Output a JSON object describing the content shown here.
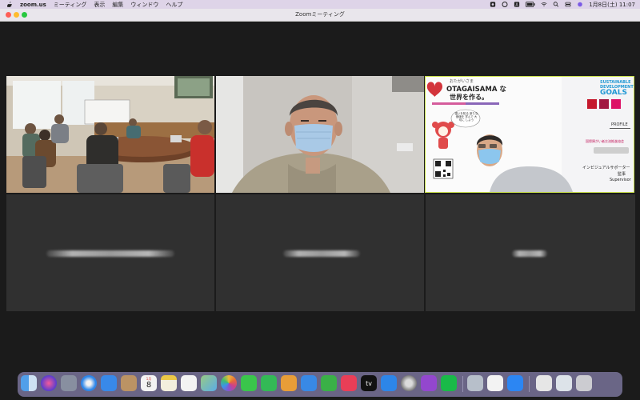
{
  "menubar": {
    "apple_icon": "apple-icon",
    "app_name": "zoom.us",
    "menus": [
      "ミーティング",
      "表示",
      "編集",
      "ウィンドウ",
      "ヘルプ"
    ],
    "datetime": "1月8日(土) 11:07"
  },
  "window": {
    "title": "Zoomミーティング"
  },
  "video_tiles": [
    {
      "type": "conference-room"
    },
    {
      "type": "participant-masked"
    },
    {
      "type": "presentation-slide"
    },
    {
      "type": "video-off"
    },
    {
      "type": "video-off"
    },
    {
      "type": "video-off"
    }
  ],
  "slide": {
    "logo_top": "おたがいさま",
    "headline_1": "OTAGAISAMA な",
    "headline_2": "世界を作る。",
    "sdg_title_1": "SUSTAINABLE",
    "sdg_title_2": "DEVELOPMENT",
    "sdg_title_3": "GOALS",
    "profile": "PROFILE",
    "org": "国際障がい者交流推進協会",
    "role_1": "インビジュアルサポーター",
    "role_2": "監事",
    "role_3": "Supervisor",
    "speech": "違いを知る 新たな価値を 学んで 大切に しよう"
  },
  "dock": {
    "calendar_month": "1月",
    "calendar_day": "8",
    "tv_label": "tv",
    "icons": [
      "finder-icon",
      "siri-icon",
      "launchpad-icon",
      "safari-icon",
      "mail-icon",
      "contacts-icon",
      "calendar-icon",
      "notes-icon",
      "reminders-icon",
      "maps-icon",
      "photos-icon",
      "messages-icon",
      "facetime-icon",
      "pages-icon",
      "keynote-icon",
      "numbers-icon",
      "music-icon",
      "appletv-icon",
      "appstore-icon",
      "settings-icon",
      "podcasts-icon",
      "line-icon",
      "preview-icon",
      "textedit-icon",
      "zoom-icon",
      "document-icon",
      "folder-icon",
      "trash-icon"
    ]
  },
  "colors": {
    "menubar_bg": "#ded4e8",
    "meeting_bg": "#1b1b1b",
    "active_speaker_border": "#c9e04a",
    "zoom_blue": "#2d8cff"
  }
}
